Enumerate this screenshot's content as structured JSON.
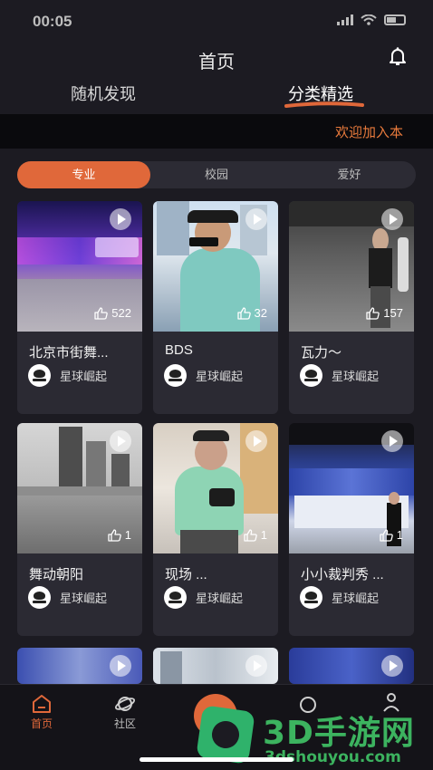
{
  "status": {
    "time": "00:05"
  },
  "header": {
    "title": "首页"
  },
  "top_tabs": [
    {
      "label": "随机发现"
    },
    {
      "label": "分类精选"
    }
  ],
  "marquee": {
    "text": "欢迎加入本"
  },
  "segments": [
    {
      "label": "专业",
      "active": true
    },
    {
      "label": "校园",
      "active": false
    },
    {
      "label": "爱好",
      "active": false
    }
  ],
  "cards": [
    {
      "title": "北京市街舞...",
      "likes": "522",
      "author": "星球崛起"
    },
    {
      "title": "BDS",
      "likes": "32",
      "author": "星球崛起"
    },
    {
      "title": "瓦力～",
      "likes": "157",
      "author": "星球崛起"
    },
    {
      "title": "舞动朝阳",
      "likes": "1",
      "author": "星球崛起"
    },
    {
      "title": "现场 ...",
      "likes": "1",
      "author": "星球崛起"
    },
    {
      "title": "小小裁判秀 ...",
      "likes": "1",
      "author": "星球崛起"
    }
  ],
  "bottom_nav": [
    {
      "label": "首页",
      "icon": "home-icon",
      "active": true
    },
    {
      "label": "社区",
      "icon": "planet-icon",
      "active": false
    }
  ],
  "watermark": {
    "title": "3D手游网",
    "url": "3dshouyou.com"
  },
  "colors": {
    "accent": "#e0683a",
    "background": "#1c1b22",
    "card": "#2b2a33"
  }
}
